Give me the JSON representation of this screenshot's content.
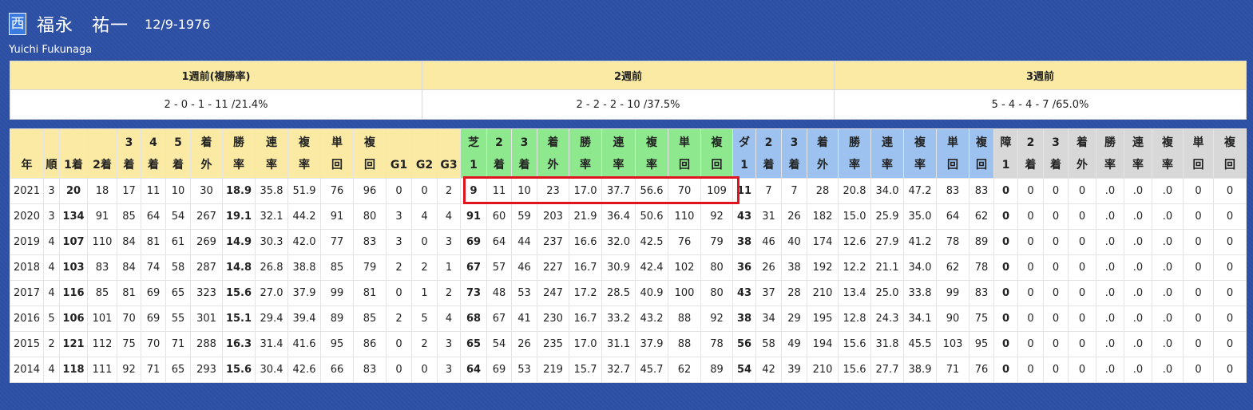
{
  "jockey": {
    "region_badge": "西",
    "name_jp": "福永　祐一",
    "birth_date": "12/9-1976",
    "name_en": "Yuichi Fukunaga"
  },
  "weeks": {
    "headers": [
      "1週前(複勝率)",
      "2週前",
      "3週前"
    ],
    "values": [
      "2 - 0 - 1 - 11 /21.4%",
      "2 - 2 - 2 - 10 /37.5%",
      "5 - 4 - 4 - 7 /65.0%"
    ]
  },
  "stats": {
    "headers": [
      [
        "年"
      ],
      [
        "順"
      ],
      [
        "1着"
      ],
      [
        "2着"
      ],
      [
        "3",
        "着"
      ],
      [
        "4",
        "着"
      ],
      [
        "5",
        "着"
      ],
      [
        "着",
        "外"
      ],
      [
        "勝",
        "率"
      ],
      [
        "連",
        "率"
      ],
      [
        "複",
        "率"
      ],
      [
        "単",
        "回"
      ],
      [
        "複",
        "回"
      ],
      [
        "G1"
      ],
      [
        "G2"
      ],
      [
        "G3"
      ],
      [
        "芝",
        "1"
      ],
      [
        "2",
        "着"
      ],
      [
        "3",
        "着"
      ],
      [
        "着",
        "外"
      ],
      [
        "勝",
        "率"
      ],
      [
        "連",
        "率"
      ],
      [
        "複",
        "率"
      ],
      [
        "単",
        "回"
      ],
      [
        "複",
        "回"
      ],
      [
        "ダ",
        "1"
      ],
      [
        "2",
        "着"
      ],
      [
        "3",
        "着"
      ],
      [
        "着",
        "外"
      ],
      [
        "勝",
        "率"
      ],
      [
        "連",
        "率"
      ],
      [
        "複",
        "率"
      ],
      [
        "単",
        "回"
      ],
      [
        "複",
        "回"
      ],
      [
        "障",
        "1"
      ],
      [
        "2",
        "着"
      ],
      [
        "3",
        "着"
      ],
      [
        "着",
        "外"
      ],
      [
        "勝",
        "率"
      ],
      [
        "連",
        "率"
      ],
      [
        "複",
        "率"
      ],
      [
        "単",
        "回"
      ],
      [
        "複",
        "回"
      ]
    ],
    "rows": [
      [
        "2021",
        "3",
        "20",
        "18",
        "17",
        "11",
        "10",
        "30",
        "18.9",
        "35.8",
        "51.9",
        "76",
        "96",
        "0",
        "0",
        "2",
        "9",
        "11",
        "10",
        "23",
        "17.0",
        "37.7",
        "56.6",
        "70",
        "109",
        "11",
        "7",
        "7",
        "28",
        "20.8",
        "34.0",
        "47.2",
        "83",
        "83",
        "0",
        "0",
        "0",
        "0",
        ".0",
        ".0",
        ".0",
        "0",
        "0"
      ],
      [
        "2020",
        "3",
        "134",
        "91",
        "85",
        "64",
        "54",
        "267",
        "19.1",
        "32.1",
        "44.2",
        "91",
        "80",
        "3",
        "4",
        "4",
        "91",
        "60",
        "59",
        "203",
        "21.9",
        "36.4",
        "50.6",
        "110",
        "92",
        "43",
        "31",
        "26",
        "182",
        "15.0",
        "25.9",
        "35.0",
        "64",
        "62",
        "0",
        "0",
        "0",
        "0",
        ".0",
        ".0",
        ".0",
        "0",
        "0"
      ],
      [
        "2019",
        "4",
        "107",
        "110",
        "84",
        "81",
        "61",
        "269",
        "14.9",
        "30.3",
        "42.0",
        "77",
        "83",
        "3",
        "0",
        "3",
        "69",
        "64",
        "44",
        "237",
        "16.6",
        "32.0",
        "42.5",
        "76",
        "79",
        "38",
        "46",
        "40",
        "174",
        "12.6",
        "27.9",
        "41.2",
        "78",
        "89",
        "0",
        "0",
        "0",
        "0",
        ".0",
        ".0",
        ".0",
        "0",
        "0"
      ],
      [
        "2018",
        "4",
        "103",
        "83",
        "84",
        "74",
        "58",
        "287",
        "14.8",
        "26.8",
        "38.8",
        "85",
        "79",
        "2",
        "2",
        "1",
        "67",
        "57",
        "46",
        "227",
        "16.7",
        "30.9",
        "42.4",
        "102",
        "80",
        "36",
        "26",
        "38",
        "192",
        "12.2",
        "21.1",
        "34.0",
        "62",
        "78",
        "0",
        "0",
        "0",
        "0",
        ".0",
        ".0",
        ".0",
        "0",
        "0"
      ],
      [
        "2017",
        "4",
        "116",
        "85",
        "81",
        "69",
        "65",
        "323",
        "15.6",
        "27.0",
        "37.9",
        "99",
        "81",
        "0",
        "1",
        "2",
        "73",
        "48",
        "53",
        "247",
        "17.2",
        "28.5",
        "40.9",
        "100",
        "80",
        "43",
        "37",
        "28",
        "210",
        "13.4",
        "25.0",
        "33.8",
        "99",
        "83",
        "0",
        "0",
        "0",
        "0",
        ".0",
        ".0",
        ".0",
        "0",
        "0"
      ],
      [
        "2016",
        "5",
        "106",
        "101",
        "70",
        "69",
        "55",
        "301",
        "15.1",
        "29.4",
        "39.4",
        "89",
        "85",
        "2",
        "5",
        "4",
        "68",
        "67",
        "41",
        "230",
        "16.7",
        "33.2",
        "43.2",
        "88",
        "92",
        "38",
        "34",
        "29",
        "195",
        "12.8",
        "24.3",
        "34.1",
        "90",
        "75",
        "0",
        "0",
        "0",
        "0",
        ".0",
        ".0",
        ".0",
        "0",
        "0"
      ],
      [
        "2015",
        "2",
        "121",
        "112",
        "75",
        "70",
        "71",
        "288",
        "16.3",
        "31.4",
        "41.6",
        "95",
        "86",
        "0",
        "2",
        "3",
        "65",
        "54",
        "26",
        "235",
        "17.0",
        "31.1",
        "37.9",
        "88",
        "78",
        "56",
        "58",
        "49",
        "194",
        "15.6",
        "31.8",
        "45.5",
        "103",
        "95",
        "0",
        "0",
        "0",
        "0",
        ".0",
        ".0",
        ".0",
        "0",
        "0"
      ],
      [
        "2014",
        "4",
        "118",
        "111",
        "92",
        "71",
        "65",
        "293",
        "15.6",
        "30.4",
        "42.6",
        "66",
        "83",
        "0",
        "0",
        "3",
        "64",
        "69",
        "53",
        "219",
        "15.7",
        "32.7",
        "45.7",
        "62",
        "89",
        "54",
        "42",
        "39",
        "210",
        "15.6",
        "27.7",
        "38.9",
        "71",
        "76",
        "0",
        "0",
        "0",
        "0",
        ".0",
        ".0",
        ".0",
        "0",
        "0"
      ]
    ]
  }
}
